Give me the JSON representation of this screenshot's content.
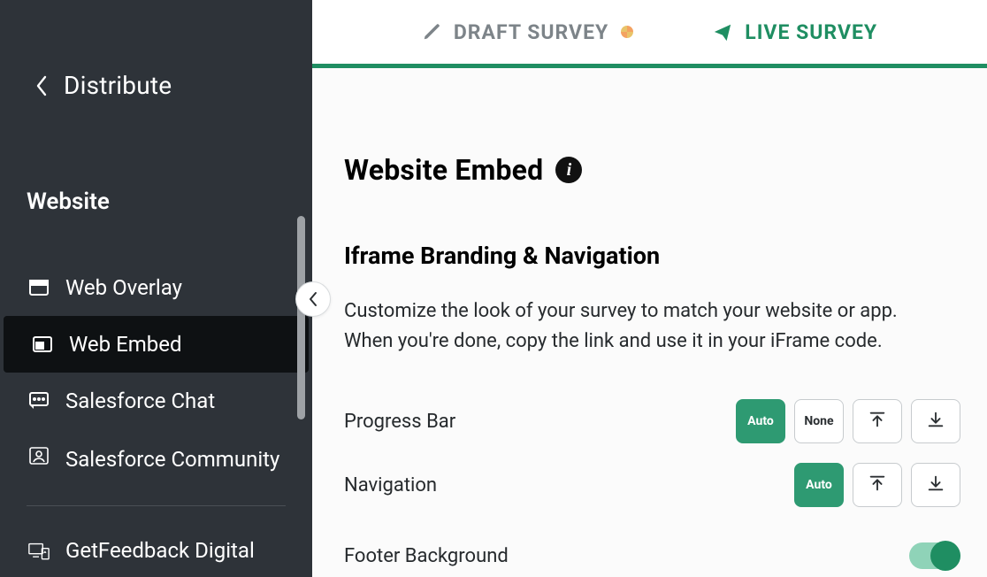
{
  "sidebar": {
    "back_label": "Distribute",
    "section": "Website",
    "items": [
      {
        "label": "Web Overlay"
      },
      {
        "label": "Web Embed"
      },
      {
        "label": "Salesforce Chat"
      },
      {
        "label": "Salesforce Community"
      },
      {
        "label": "GetFeedback Digital"
      }
    ]
  },
  "tabs": {
    "draft": "DRAFT SURVEY",
    "live": "LIVE SURVEY"
  },
  "page": {
    "title": "Website Embed",
    "info_glyph": "i",
    "subheading": "Iframe Branding & Navigation",
    "description": "Customize the look of your survey to match your website or app. When you're done, copy the link and use it in your iFrame code."
  },
  "settings": {
    "progress_bar": {
      "label": "Progress Bar",
      "options": {
        "auto": "Auto",
        "none": "None"
      }
    },
    "navigation": {
      "label": "Navigation",
      "options": {
        "auto": "Auto"
      }
    },
    "footer_bg": {
      "label": "Footer Background"
    }
  }
}
